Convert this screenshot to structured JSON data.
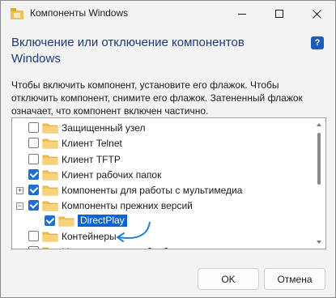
{
  "window": {
    "title": "Компоненты Windows"
  },
  "title_buttons": {
    "minimize": "—",
    "maximize": "☐",
    "close": "✕"
  },
  "heading": "Включение или отключение компонентов Windows",
  "help_glyph": "?",
  "description": "Чтобы включить компонент, установите его флажок. Чтобы отключить компонент, снимите его флажок. Затененный флажок означает, что компонент включен частично.",
  "tree": {
    "items": [
      {
        "label": "Защищенный узел",
        "checked": false,
        "expander": "",
        "selected": false
      },
      {
        "label": "Клиент Telnet",
        "checked": false,
        "expander": "",
        "selected": false
      },
      {
        "label": "Клиент TFTP",
        "checked": false,
        "expander": "",
        "selected": false
      },
      {
        "label": "Клиент рабочих папок",
        "checked": true,
        "expander": "",
        "selected": false
      },
      {
        "label": "Компоненты для работы с мультимедиа",
        "checked": true,
        "expander": "+",
        "selected": false
      },
      {
        "label": "Компоненты прежних версий",
        "checked": true,
        "expander": "−",
        "selected": false
      },
      {
        "label": "DirectPlay",
        "checked": true,
        "expander": "",
        "selected": true
      },
      {
        "label": "Контейнеры",
        "checked": false,
        "expander": "",
        "selected": false
      },
      {
        "label": "Мост для центра обработки данных",
        "checked": false,
        "expander": "",
        "selected": false
      }
    ]
  },
  "buttons": {
    "ok": "OK",
    "cancel": "Отмена"
  },
  "colors": {
    "accent": "#1f6fd1",
    "heading": "#1e3a78",
    "selection": "#0a64d0",
    "folder": "#f2c14e",
    "annotation": "#2a7fd4"
  }
}
